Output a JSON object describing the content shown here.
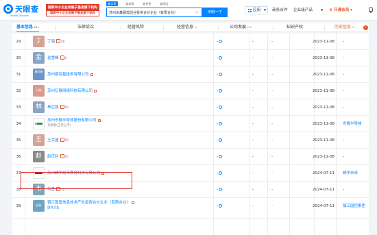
{
  "header": {
    "logo_name": "天眼查",
    "logo_domain": "TianYanCha.com",
    "promo_line1": "国家中小企业发展子基金旗下机构",
    "promo_line2": "国家中小企业发展子基金旗下机构",
    "search_tabs": [
      "查公司",
      "查老板",
      "查关系",
      "查风险"
    ],
    "search_value": "苏州永鑫融璟创业投资合伙企业（有限合伙）",
    "search_button": "天眼一下",
    "app_label": "应用",
    "nav": [
      "商务合作",
      "企业级产品"
    ],
    "vip_label": "开通会员"
  },
  "tabs": [
    {
      "label": "基本信息",
      "count": "681"
    },
    {
      "label": "法律诉讼",
      "count": ""
    },
    {
      "label": "经营风险",
      "count": ""
    },
    {
      "label": "经营信息",
      "count": "14"
    },
    {
      "label": "公司发展",
      "count": "105"
    },
    {
      "label": "知识产权",
      "count": ""
    },
    {
      "label": "历史信息",
      "count": "15"
    }
  ],
  "rows": [
    {
      "idx": "29",
      "avatar": "丁",
      "avatar_color": "#d4a393",
      "name": "丁海",
      "count": "58",
      "date": "2023-11-08",
      "link": "-"
    },
    {
      "idx": "30",
      "avatar": "金",
      "avatar_color": "#8aa4c8",
      "name": "金雪峰",
      "count": "4",
      "date": "2023-11-08",
      "link": "-"
    },
    {
      "idx": "31",
      "avatar": "康润星",
      "avatar_color": "#6b95c8",
      "name": "苏州康润星投资有限公司",
      "count": "",
      "date": "2023-11-08",
      "link": "-"
    },
    {
      "idx": "32",
      "avatar": "亿歌",
      "avatar_color": "#d89a8e",
      "name": "苏州亿歌网络科技有限公司",
      "count": "",
      "date": "2023-11-08",
      "link": "-"
    },
    {
      "idx": "33",
      "avatar": "林",
      "avatar_color": "#8aa4c8",
      "name": "林巨强",
      "count": "18",
      "date": "2023-11-08",
      "link": "-"
    },
    {
      "idx": "34",
      "avatar": "",
      "avatar_color": "#ffffff",
      "name": "苏州东微半导体股份有限公司",
      "sub": "有限制(正常上市)",
      "count": "",
      "date": "2023-11-08",
      "link": "东微半导体"
    },
    {
      "idx": "35",
      "avatar": "王",
      "avatar_color": "#d4a393",
      "name": "王克盛",
      "count": "20",
      "date": "2023-11-08",
      "link": "-"
    },
    {
      "idx": "36",
      "avatar": "赵",
      "avatar_color": "#8a8a8a",
      "name": "赵庆利",
      "count": "10",
      "date": "2023-11-08",
      "link": "-"
    },
    {
      "idx": "37",
      "avatar": "",
      "avatar_color": "#ffffff",
      "name": "苏州峰学前来教育科技有限公司",
      "count": "",
      "date": "2024-07-11",
      "link": "峰学未来"
    },
    {
      "idx": "38",
      "avatar": "韦",
      "avatar_color": "#7fa6b8",
      "name": "韦勇",
      "count": "52",
      "date": "2024-07-11",
      "link": "-"
    },
    {
      "idx": "39",
      "avatar": "苏高",
      "avatar_color": "#6fa3c6",
      "name": "镇江国富信息技术产业投资合伙企业（有限合伙）",
      "sub": "国有企业",
      "count": "",
      "date": "2024-07-11",
      "link": "镇江国控集团"
    }
  ],
  "dash": "-",
  "colors": {
    "brand": "#0084ff",
    "highlight": "#e5231e",
    "accent": "#e35a2b"
  }
}
